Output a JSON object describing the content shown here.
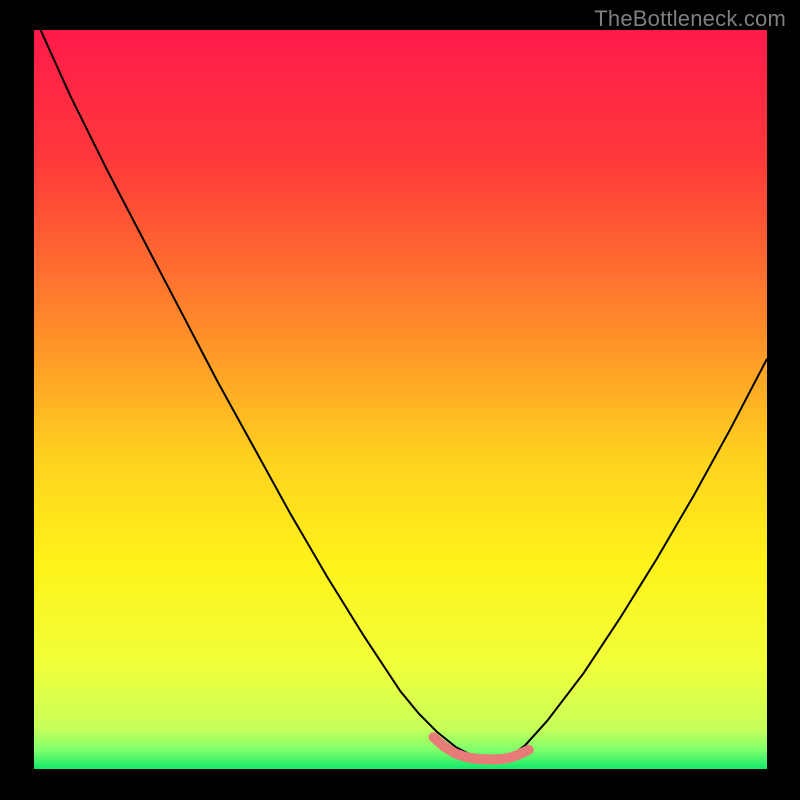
{
  "watermark": "TheBottleneck.com",
  "chart_data": {
    "type": "line",
    "title": "",
    "xlabel": "",
    "ylabel": "",
    "xlim": [
      0,
      100
    ],
    "ylim": [
      0,
      100
    ],
    "gradient_stops": [
      {
        "offset": 0,
        "color": "#ff1a4b"
      },
      {
        "offset": 0.18,
        "color": "#ff3a3a"
      },
      {
        "offset": 0.4,
        "color": "#ff8a2a"
      },
      {
        "offset": 0.58,
        "color": "#ffd21f"
      },
      {
        "offset": 0.72,
        "color": "#fff21a"
      },
      {
        "offset": 0.86,
        "color": "#f0ff3a"
      },
      {
        "offset": 0.945,
        "color": "#c8ff5a"
      },
      {
        "offset": 0.975,
        "color": "#7dff6a"
      },
      {
        "offset": 1.0,
        "color": "#12e96b"
      }
    ],
    "series": [
      {
        "name": "curve",
        "color": "#000000",
        "width": 2,
        "x": [
          0.9,
          5,
          10,
          15,
          20,
          25,
          30,
          35,
          40,
          45,
          50,
          52.5,
          55,
          57.5,
          60,
          62,
          63,
          64,
          65,
          67,
          70,
          75,
          80,
          85,
          90,
          95,
          100
        ],
        "y": [
          100,
          91,
          81,
          71.5,
          62,
          52.5,
          43.5,
          34.5,
          26,
          18,
          10.5,
          7.5,
          5,
          3,
          1.7,
          1.2,
          1.15,
          1.25,
          1.7,
          3.2,
          6.5,
          13,
          20.5,
          28.5,
          37,
          46,
          55.5
        ]
      },
      {
        "name": "highlight",
        "color": "#e77b78",
        "width": 10,
        "linecap": "round",
        "x": [
          54.5,
          56,
          57.5,
          59,
          60.5,
          62,
          63,
          64,
          65,
          66,
          67.5
        ],
        "y": [
          4.3,
          3.0,
          2.1,
          1.6,
          1.35,
          1.3,
          1.3,
          1.35,
          1.55,
          1.9,
          2.6
        ]
      }
    ]
  }
}
